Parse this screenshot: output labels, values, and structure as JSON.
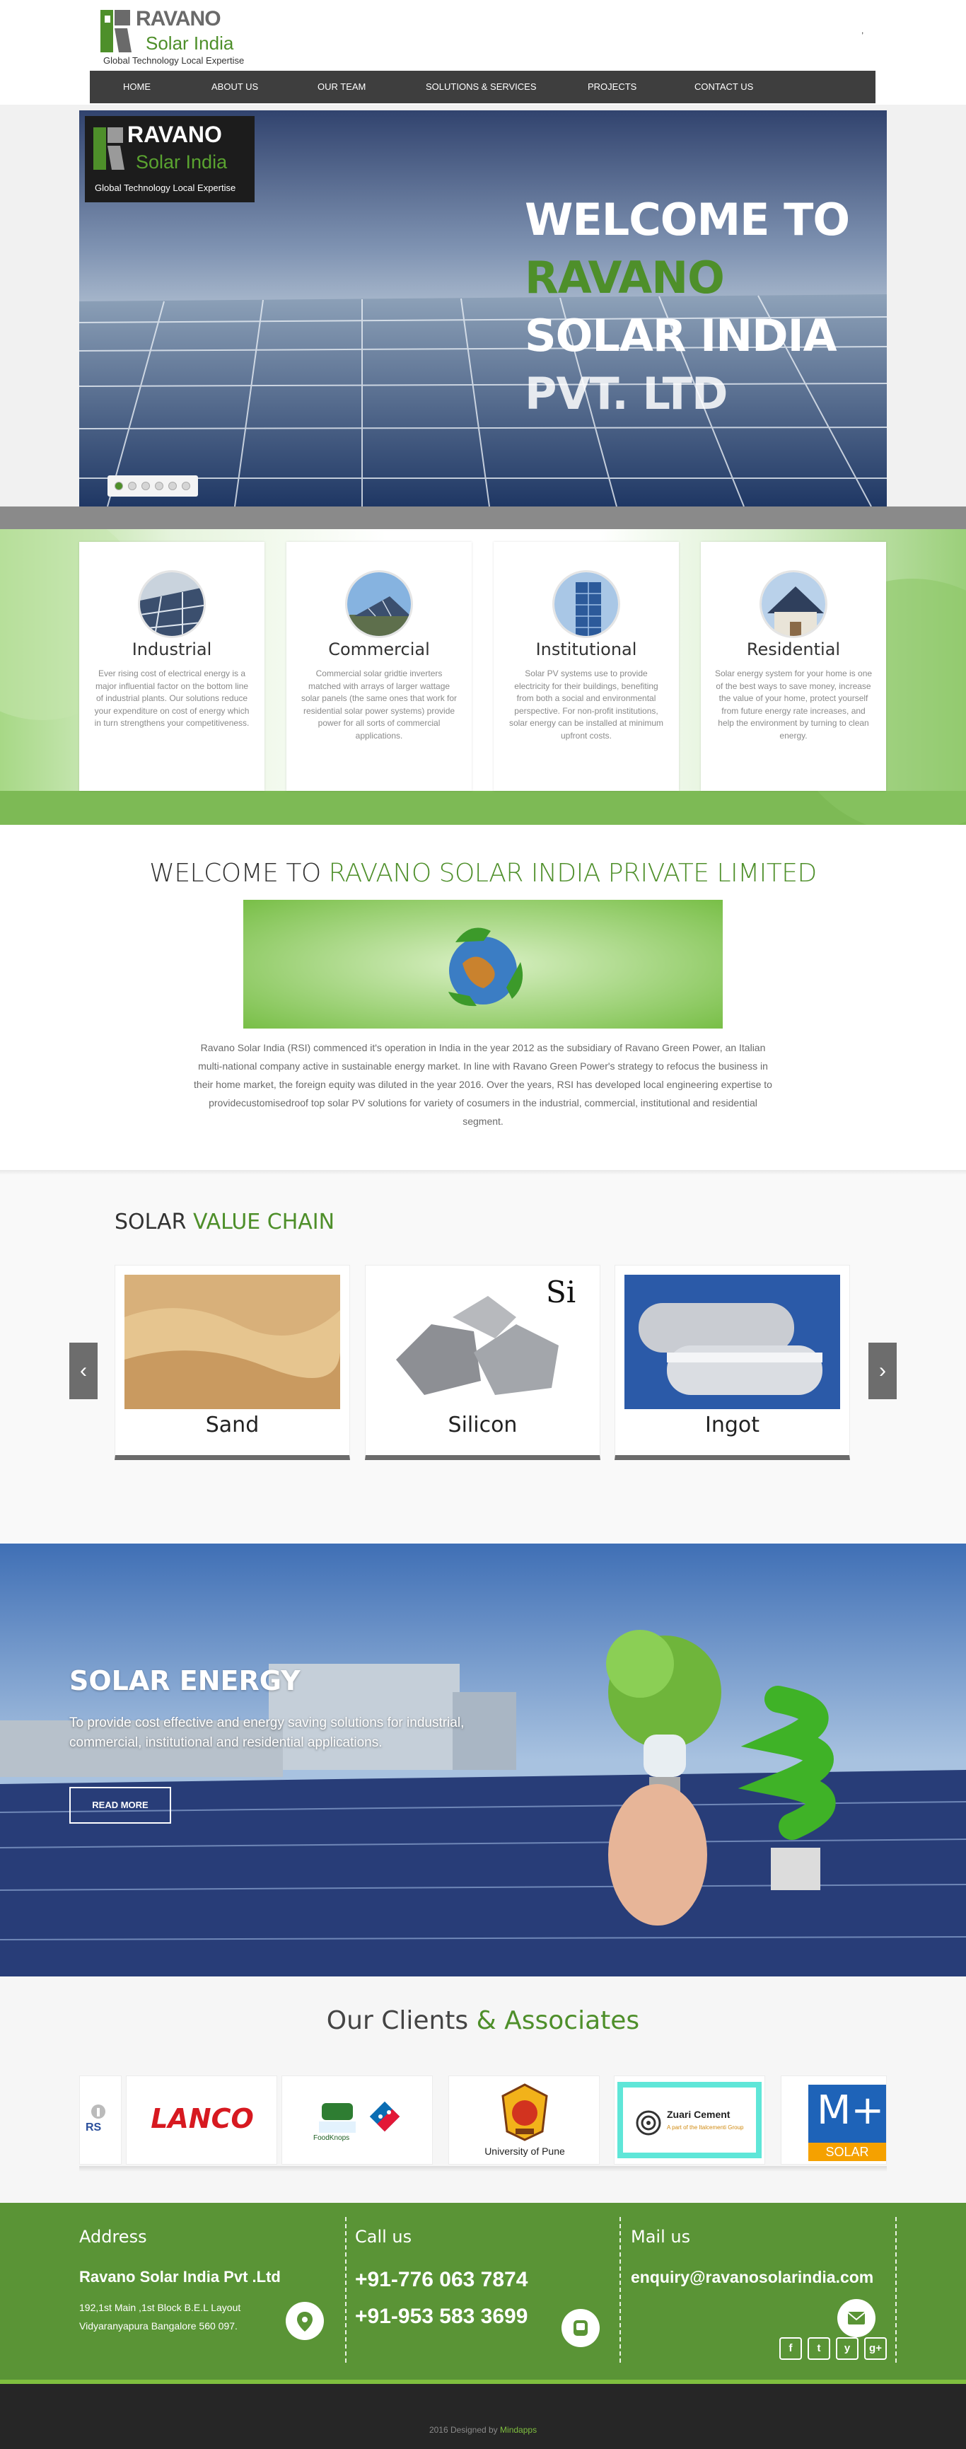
{
  "brand": {
    "name_top": "RAVANO",
    "name_bottom": "Solar India",
    "tagline": "Global Technology Local Expertise",
    "green": "#4e8f2a",
    "grey": "#6a6a6a"
  },
  "header": {
    "top_right_mark": ","
  },
  "nav": {
    "items": [
      {
        "label": "HOME"
      },
      {
        "label": "ABOUT US"
      },
      {
        "label": "OUR TEAM"
      },
      {
        "label": "SOLUTIONS & SERVICES"
      },
      {
        "label": "PROJECTS"
      },
      {
        "label": "CONTACT US"
      }
    ]
  },
  "hero": {
    "line1": "WELCOME TO",
    "line2": "RAVANO",
    "line3": "SOLAR INDIA",
    "line4": "PVT. LTD",
    "slides": 6
  },
  "services": [
    {
      "title": "Industrial",
      "text": "Ever rising cost of electrical energy is a major influential factor on the bottom line of industrial plants. Our solutions reduce your expenditure on cost of energy which in turn strengthens your competitiveness."
    },
    {
      "title": "Commercial",
      "text": "Commercial solar gridtie inverters matched with arrays of larger wattage solar panels (the same ones that work for residential solar power systems) provide power for all sorts of commercial applications."
    },
    {
      "title": "Institutional",
      "text": "Solar PV systems use to provide electricity for their buildings, benefiting from both a social and environmental perspective. For non-profit institutions, solar energy can be installed at minimum upfront costs."
    },
    {
      "title": "Residential",
      "text": "Solar energy system for your home is one of the best ways to save money, increase the value of your home, protect yourself from future energy rate increases, and help the environment by turning to clean energy."
    }
  ],
  "welcome": {
    "title_plain": "WELCOME TO",
    "title_green": "RAVANO SOLAR INDIA PRIVATE LIMITED",
    "text": "Ravano Solar India (RSI) commenced it's operation in India in the year 2012 as the subsidiary of Ravano Green Power, an Italian multi-national company active in sustainable energy market. In line with Ravano Green Power's strategy to refocus the business in their home market, the foreign equity was diluted in the year 2016. Over the years, RSI has developed local engineering expertise to providecustomisedroof top solar PV solutions for variety of cosumers in the industrial, commercial, institutional and residential segment."
  },
  "value_chain": {
    "title_plain": "SOLAR",
    "title_green": "VALUE CHAIN",
    "items": [
      {
        "label": "Sand"
      },
      {
        "label": "Silicon",
        "badge": "Si"
      },
      {
        "label": "Ingot"
      }
    ]
  },
  "energy": {
    "title": "SOLAR ENERGY",
    "subtitle": "To provide cost effective and energy saving solutions for industrial, commercial, institutional and residential applications.",
    "button": "READ MORE"
  },
  "clients": {
    "title_plain": "Our Clients",
    "title_green": "& Associates",
    "items": [
      {
        "name": "RS"
      },
      {
        "name": "LANCO"
      },
      {
        "name": "FoodKnops",
        "extra": "Domino's"
      },
      {
        "name": "University of Pune"
      },
      {
        "name": "Zuari Cement",
        "extra": "A part of the Italcementi Group"
      },
      {
        "name": "M+",
        "extra": "SOLAR"
      }
    ]
  },
  "footer": {
    "address": {
      "heading": "Address",
      "company": "Ravano Solar India Pvt .Ltd",
      "line1": "192,1st Main ,1st Block B.E.L Layout",
      "line2": "Vidyaranyapura Bangalore 560 097."
    },
    "call": {
      "heading": "Call us",
      "phone1": "+91-776 063 7874",
      "phone2": "+91-953 583 3699"
    },
    "mail": {
      "heading": "Mail us",
      "email": "enquiry@ravanosolarindia.com"
    },
    "social": [
      "f",
      "t",
      "y",
      "g+"
    ]
  },
  "copyright": {
    "text": "2016 Designed by",
    "link": "Mindapps"
  }
}
